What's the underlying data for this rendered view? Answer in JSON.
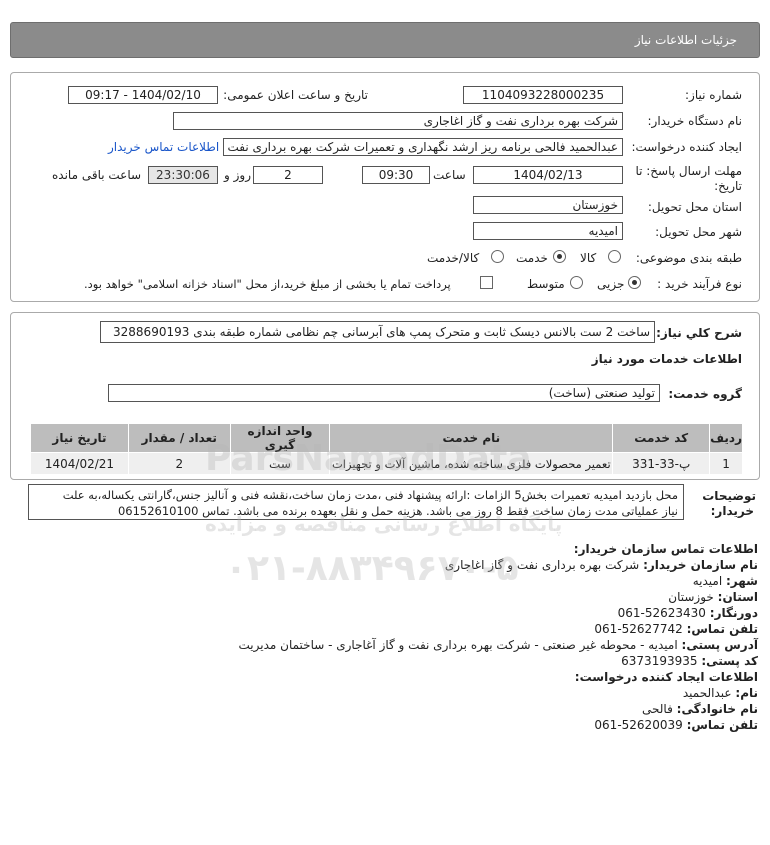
{
  "header": {
    "title": "جزئیات اطلاعات نیاز"
  },
  "form": {
    "need_number_label": "شماره نیاز:",
    "need_number": "1104093228000235",
    "announce_label": "تاریخ و ساعت اعلان عمومی:",
    "announce_value": "1404/02/10 - 09:17",
    "buyer_org_label": "نام دستگاه خریدار:",
    "buyer_org": "شرکت بهره برداری نفت و گاز اغاجاری",
    "creator_label": "ایجاد کننده درخواست:",
    "creator": "عبدالحمید فالحی برنامه ریز ارشد نگهداری و تعمیرات شرکت بهره برداری نفت و",
    "contact_link": "اطلاعات تماس خریدار",
    "deadline_label_1": "مهلت ارسال پاسخ: تا",
    "deadline_label_2": "تاریخ:",
    "deadline_date": "1404/02/13",
    "time_label": "ساعت",
    "deadline_time": "09:30",
    "days_value": "2",
    "days_label": "روز و",
    "remaining_time": "23:30:06",
    "remaining_label": "ساعت باقی مانده",
    "province_label": "استان محل تحویل:",
    "province": "خوزستان",
    "city_label": "شهر محل تحویل:",
    "city": "امیدیه",
    "category_label": "طبقه بندی موضوعی:",
    "category_options": [
      "کالا",
      "خدمت",
      "کالا/خدمت"
    ],
    "category_selected": "خدمت",
    "process_label": "نوع فرآیند خرید :",
    "process_options": [
      "جزیی",
      "متوسط"
    ],
    "process_selected": "جزیی",
    "payment_note": "پرداخت تمام یا بخشی از مبلغ خرید،از محل \"اسناد خزانه اسلامی\" خواهد بود."
  },
  "summary": {
    "label": "شرح کلي نياز:",
    "value": "ساخت 2 ست بالانس دیسک ثابت و متحرک پمپ های آبرسانی چم نظامی شماره طبقه بندی 3288690193"
  },
  "services": {
    "section_title": "اطلاعات خدمات مورد نیاز",
    "group_label": "گروه خدمت:",
    "group_value": "تولید صنعتی (ساخت)",
    "table": {
      "headers": [
        "ردیف",
        "کد خدمت",
        "نام خدمت",
        "واحد اندازه گیری",
        "تعداد / مقدار",
        "تاریخ نیاز"
      ],
      "rows": [
        [
          "1",
          "پ-33-331",
          "تعمیر محصولات فلزی ساخته شده، ماشین آلات و تجهیزات",
          "ست",
          "2",
          "1404/02/21"
        ]
      ]
    }
  },
  "notes": {
    "label_1": "توضیحات",
    "label_2": "خریدار:",
    "line_1": "محل بازدید امیدیه تعمیرات بخش5 الزامات :ارائه پیشنهاد فنی ،مدت زمان ساخت،نقشه فنی و آنالیز جنس،گارانتی یکساله،به علت",
    "line_2": "نیاز عملیاتی مدت زمان ساخت فقط 8 روز می باشد. هزینه حمل و نقل بعهده برنده می باشد. تماس 06152610100"
  },
  "contact": {
    "org_title": "اطلاعات تماس سازمان خریدار:",
    "org_name_k": "نام سازمان خریدار:",
    "org_name_v": "شرکت بهره برداری نفت و گاز اغاجاری",
    "city_k": "شهر:",
    "city_v": "امیدیه",
    "province_k": "استان:",
    "province_v": "خوزستان",
    "fax_k": "دورنگار:",
    "fax_v": "52623430-061",
    "phone_k": "تلفن تماس:",
    "phone_v": "52627742-061",
    "address_k": "آدرس پستی:",
    "address_v": "امیدیه - محوطه غیر صنعتی - شرکت بهره برداری نفت و گاز آغاجاری - ساختمان مدیریت",
    "postal_k": "کد پستی:",
    "postal_v": "6373193935",
    "creator_title": "اطلاعات ایجاد کننده درخواست:",
    "name_k": "نام:",
    "name_v": "عبدالحمید",
    "family_k": "نام خانوادگی:",
    "family_v": "فالحی",
    "cphone_k": "تلفن تماس:",
    "cphone_v": "52620039-061"
  },
  "watermark": {
    "line_1": "ParsNamadData",
    "line_2": "پایگاه اطلاع رسانی مناقصه و مزایده",
    "line_3": "۰۲۱-۸۸۳۴۹۶۷۰-۵"
  },
  "colors": {
    "header_bg": "#8b8b8b",
    "link": "#1a56c9",
    "table_header": "#bdbdbd"
  }
}
